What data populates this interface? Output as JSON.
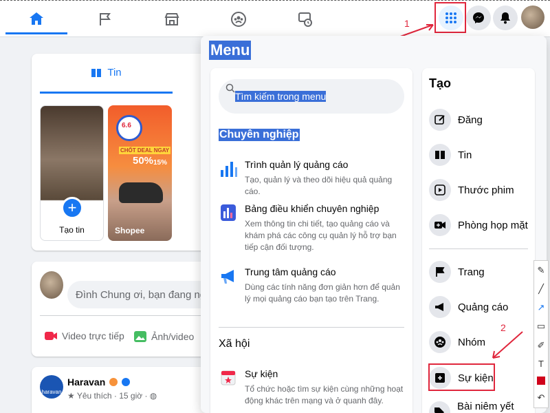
{
  "menu": {
    "title": "Menu",
    "search_placeholder": "Tìm kiếm trong menu",
    "sections": [
      {
        "heading": "Chuyên nghiệp",
        "items": [
          {
            "title": "Trình quản lý quảng cáo",
            "description": "Tạo, quản lý và theo dõi hiệu quả quảng cáo.",
            "icon": "bar-chart-icon"
          },
          {
            "title": "Bảng điều khiển chuyên nghiệp",
            "description": "Xem thông tin chi tiết, tạo quảng cáo và khám phá các công cụ quản lý hỗ trợ bạn tiếp cận đối tượng.",
            "icon": "dashboard-icon"
          },
          {
            "title": "Trung tâm quảng cáo",
            "description": "Dùng các tính năng đơn giản hơn để quản lý mọi quảng cáo bạn tạo trên Trang.",
            "icon": "megaphone-icon"
          }
        ]
      },
      {
        "heading": "Xã hội",
        "items": [
          {
            "title": "Sự kiện",
            "description": "Tổ chức hoặc tìm sự kiện cùng những hoạt động khác trên mạng và ở quanh đây.",
            "icon": "calendar-icon"
          }
        ]
      }
    ],
    "create": {
      "heading": "Tạo",
      "items": [
        "Đăng",
        "Tin",
        "Thước phim",
        "Phòng họp mặt",
        "Trang",
        "Quảng cáo",
        "Nhóm",
        "Sự kiện",
        "Bài niêm yết trên"
      ]
    }
  },
  "feed": {
    "stories_tab": "Tin",
    "create_story": "Tạo tin",
    "shopee_story": "Shopee",
    "story_promo": [
      "6.6",
      "CHỐT DEAL NGAY",
      "50%",
      "15%"
    ],
    "composer_placeholder": "Đình Chung ơi, bạn đang nghĩ gì?",
    "actions": [
      "Video trực tiếp",
      "Ảnh/video"
    ],
    "post": {
      "author": "Haravan",
      "meta": "Yêu thích · 15 giờ ·",
      "avatar_text": "haravan"
    }
  },
  "annotations": [
    "1",
    "2"
  ],
  "colors": {
    "accent": "#1877f2",
    "highlight": "#3a6fd8",
    "annotation": "#e0263c"
  }
}
